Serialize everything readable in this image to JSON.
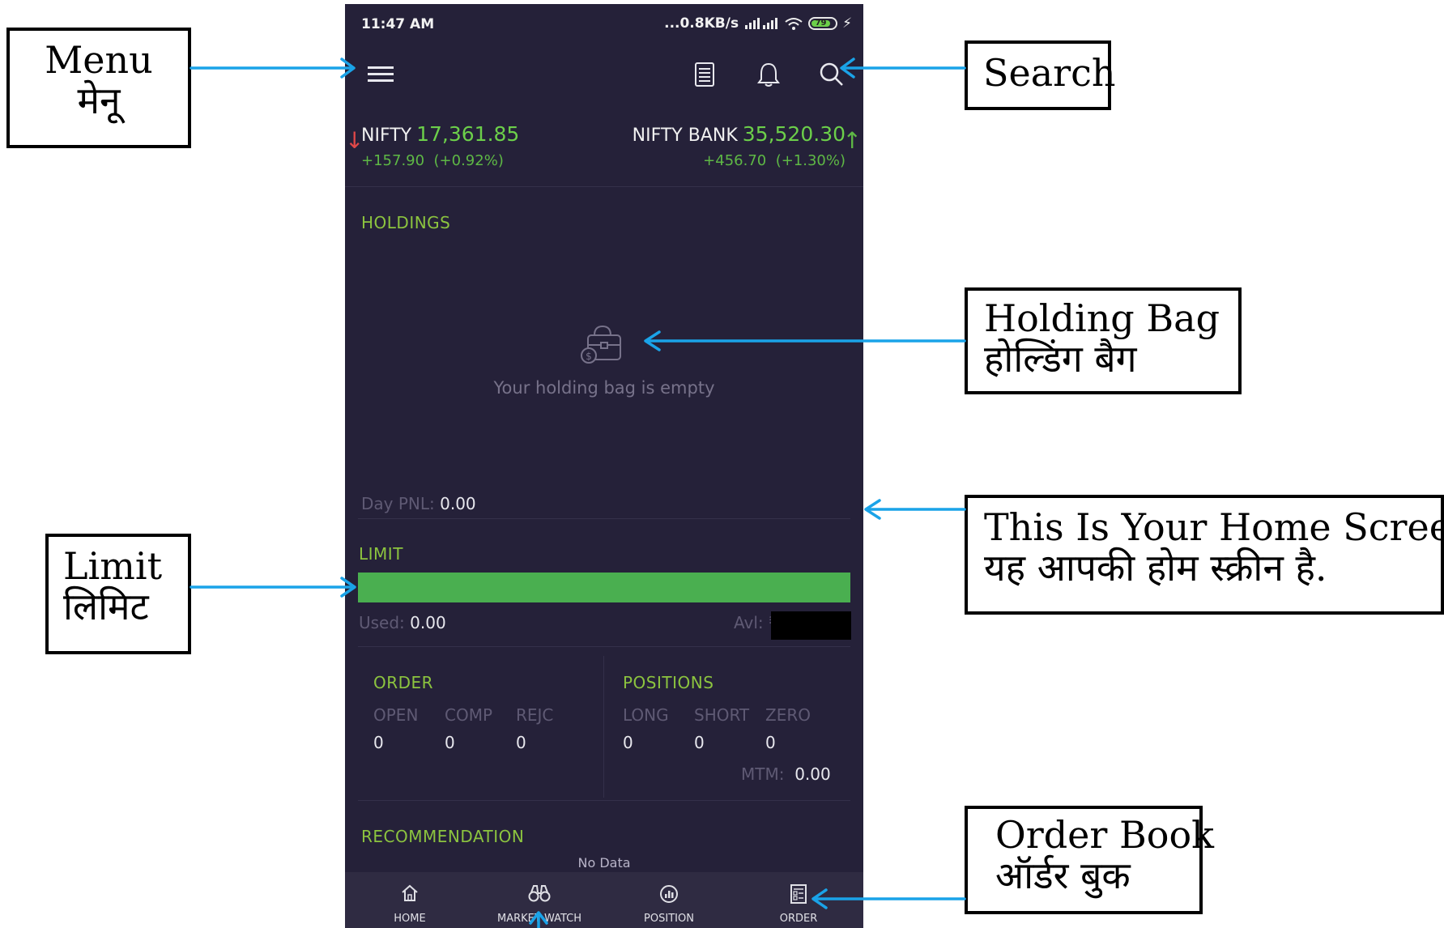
{
  "status_bar": {
    "time": "11:47 AM",
    "network": "...0.8KB/s",
    "battery": "79"
  },
  "topbar": {
    "icons": [
      "menu-icon",
      "document-icon",
      "bell-icon",
      "search-icon"
    ]
  },
  "tickers": [
    {
      "name": "NIFTY",
      "value": "17,361.85",
      "change": "+157.90",
      "change_pct": "(+0.92%)",
      "arrow": "↓"
    },
    {
      "name": "NIFTY BANK",
      "value": "35,520.30",
      "change": "+456.70",
      "change_pct": "(+1.30%)",
      "arrow": "↑"
    }
  ],
  "holdings": {
    "title": "HOLDINGS",
    "empty_text": "Your holding bag is empty",
    "day_pnl_label": "Day PNL:",
    "day_pnl_value": "0.00"
  },
  "limit": {
    "title": "LIMIT",
    "used_label": "Used:",
    "used_value": "0.00",
    "available_label": "Avl: ₹"
  },
  "order": {
    "title": "ORDER",
    "columns": [
      "OPEN",
      "COMP",
      "REJC"
    ],
    "values": [
      "0",
      "0",
      "0"
    ]
  },
  "positions": {
    "title": "POSITIONS",
    "columns": [
      "LONG",
      "SHORT",
      "ZERO"
    ],
    "values": [
      "0",
      "0",
      "0"
    ],
    "mtm_label": "MTM:",
    "mtm_value": "0.00"
  },
  "recommendation": {
    "title": "RECOMMENDATION",
    "empty_text": "No Data"
  },
  "bottom_nav": [
    {
      "label": "HOME",
      "icon": "home-icon"
    },
    {
      "label": "MARKET WATCH",
      "icon": "binoculars-icon"
    },
    {
      "label": "POSITION",
      "icon": "position-icon"
    },
    {
      "label": "ORDER",
      "icon": "order-book-icon"
    }
  ],
  "annotations": {
    "menu": [
      "Menu",
      "मेनू"
    ],
    "search": [
      "Search"
    ],
    "holding_bag": [
      "Holding Bag",
      "होल्डिंग बैग"
    ],
    "home_screen": [
      "This Is Your Home Screen",
      "यह आपकी होम स्क्रीन है."
    ],
    "limit": [
      "Limit",
      "लिमिट"
    ],
    "order_book": [
      "Order Book",
      "ऑर्डर बुक"
    ]
  },
  "colors": {
    "background": "#252139",
    "accent_green": "#8cc43f",
    "positive": "#6ccf4a",
    "negative": "#e04848",
    "arrow": "#1aa3e8"
  }
}
